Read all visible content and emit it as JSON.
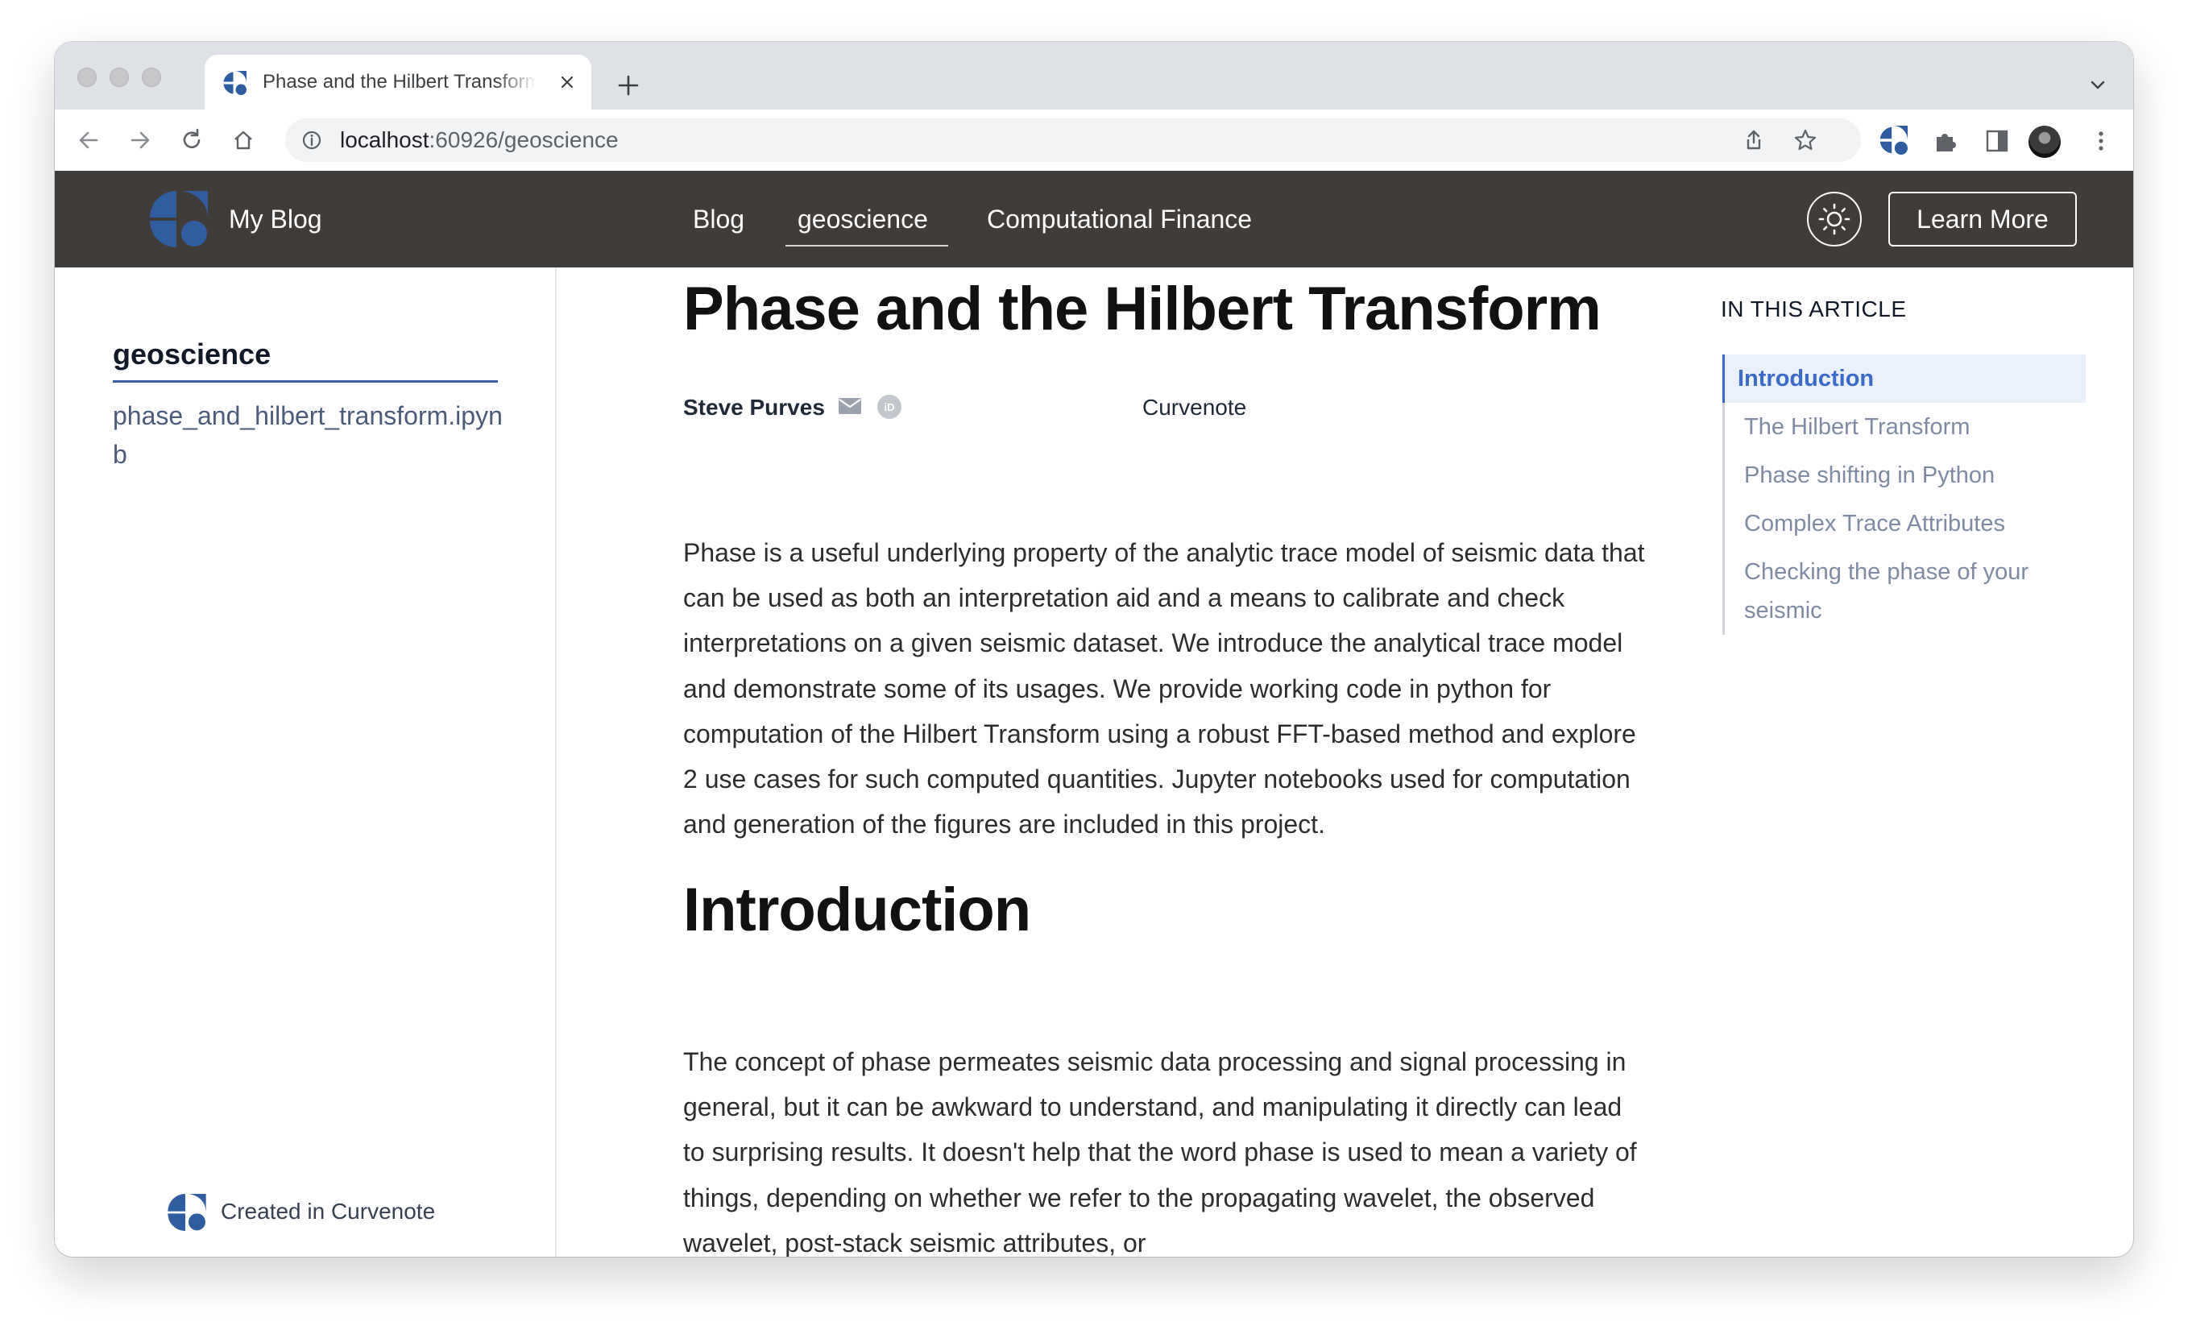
{
  "browser": {
    "tab_title": "Phase and the Hilbert Transform",
    "url_host": "localhost",
    "url_path": ":60926/geoscience"
  },
  "site": {
    "name": "My Blog",
    "nav": [
      "Blog",
      "geoscience",
      "Computational Finance"
    ],
    "active_nav": "geoscience",
    "learn_more": "Learn More",
    "brand_color": "#2f5da0",
    "header_color": "#403c39"
  },
  "sidebar": {
    "title": "geoscience",
    "link": "phase_and_hilbert_transform.ipynb",
    "footer": "Created in Curvenote"
  },
  "article": {
    "title": "Phase and the Hilbert Transform",
    "author": "Steve Purves",
    "affiliation": "Curvenote",
    "abstract": "Phase is a useful underlying property of the analytic trace model of seismic data that can be used as both an interpretation aid and a means to calibrate and check interpretations on a given seismic dataset. We introduce the analytical trace model and demonstrate some of its usages. We provide working code in python for computation of the Hilbert Transform using a robust FFT-based method and explore 2 use cases for such computed quantities. Jupyter notebooks used for computation and generation of the figures are included in this project.",
    "heading": "Introduction",
    "intro": "The concept of phase permeates seismic data processing and signal processing in general, but it can be awkward to understand, and manipulating it directly can lead to surprising results. It doesn't help that the word phase is used to mean a variety of things, depending on whether we refer to the propagating wavelet, the observed wavelet, post-stack seismic attributes, or"
  },
  "toc": {
    "heading": "IN THIS ARTICLE",
    "items": [
      "Introduction",
      "The Hilbert Transform",
      "Phase shifting in Python",
      "Complex Trace Attributes",
      "Checking the phase of your seismic"
    ],
    "active": "Introduction"
  }
}
